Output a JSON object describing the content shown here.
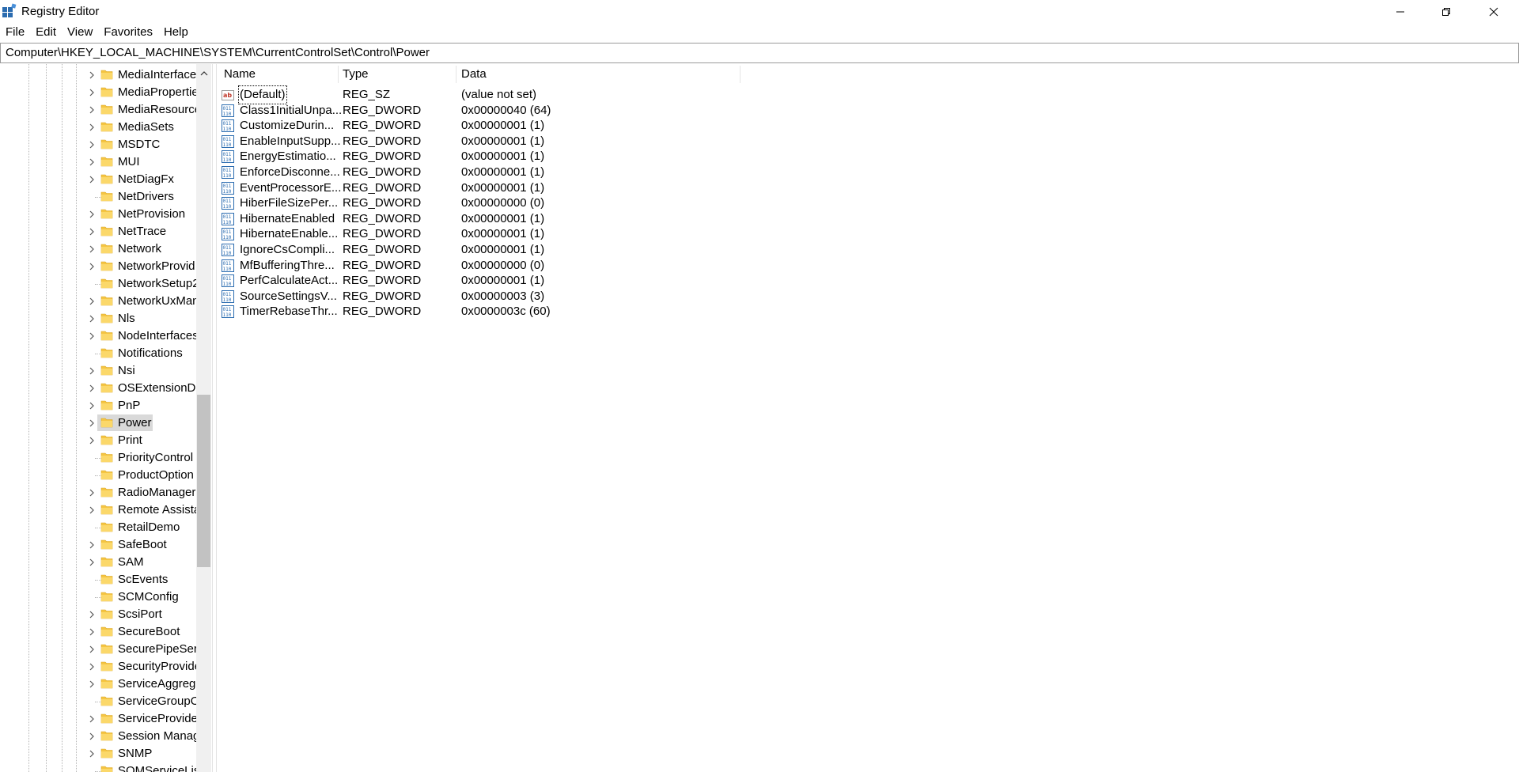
{
  "window": {
    "title": "Registry Editor",
    "icon": "registry-editor-icon",
    "controls": [
      "minimize",
      "maximize",
      "close"
    ]
  },
  "menu": [
    "File",
    "Edit",
    "View",
    "Favorites",
    "Help"
  ],
  "address": {
    "path": "Computer\\HKEY_LOCAL_MACHINE\\SYSTEM\\CurrentControlSet\\Control\\Power"
  },
  "tree": {
    "items": [
      {
        "label": "MediaInterface",
        "expandable": true
      },
      {
        "label": "MediaPropertie",
        "expandable": true
      },
      {
        "label": "MediaResource",
        "expandable": true
      },
      {
        "label": "MediaSets",
        "expandable": true
      },
      {
        "label": "MSDTC",
        "expandable": true
      },
      {
        "label": "MUI",
        "expandable": true
      },
      {
        "label": "NetDiagFx",
        "expandable": true
      },
      {
        "label": "NetDrivers",
        "expandable": false
      },
      {
        "label": "NetProvision",
        "expandable": true
      },
      {
        "label": "NetTrace",
        "expandable": true
      },
      {
        "label": "Network",
        "expandable": true
      },
      {
        "label": "NetworkProvid",
        "expandable": true
      },
      {
        "label": "NetworkSetup2",
        "expandable": false
      },
      {
        "label": "NetworkUxMan",
        "expandable": true
      },
      {
        "label": "Nls",
        "expandable": true
      },
      {
        "label": "NodeInterfaces",
        "expandable": true
      },
      {
        "label": "Notifications",
        "expandable": false
      },
      {
        "label": "Nsi",
        "expandable": true
      },
      {
        "label": "OSExtensionDa",
        "expandable": true
      },
      {
        "label": "PnP",
        "expandable": true
      },
      {
        "label": "Power",
        "expandable": true,
        "selected": true
      },
      {
        "label": "Print",
        "expandable": true
      },
      {
        "label": "PriorityControl",
        "expandable": false
      },
      {
        "label": "ProductOption",
        "expandable": false
      },
      {
        "label": "RadioManager",
        "expandable": true
      },
      {
        "label": "Remote Assista",
        "expandable": true
      },
      {
        "label": "RetailDemo",
        "expandable": false
      },
      {
        "label": "SafeBoot",
        "expandable": true
      },
      {
        "label": "SAM",
        "expandable": true
      },
      {
        "label": "ScEvents",
        "expandable": false
      },
      {
        "label": "SCMConfig",
        "expandable": false
      },
      {
        "label": "ScsiPort",
        "expandable": true
      },
      {
        "label": "SecureBoot",
        "expandable": true
      },
      {
        "label": "SecurePipeServ",
        "expandable": true
      },
      {
        "label": "SecurityProvide",
        "expandable": true
      },
      {
        "label": "ServiceAggreg",
        "expandable": true
      },
      {
        "label": "ServiceGroupO",
        "expandable": false
      },
      {
        "label": "ServiceProvide",
        "expandable": true
      },
      {
        "label": "Session Manag",
        "expandable": true
      },
      {
        "label": "SNMP",
        "expandable": true
      },
      {
        "label": "SQMServiceLis",
        "expandable": false
      }
    ]
  },
  "list": {
    "columns": [
      "Name",
      "Type",
      "Data"
    ],
    "rows": [
      {
        "name": "(Default)",
        "type": "REG_SZ",
        "data": "(value not set)",
        "icon": "string-value-icon"
      },
      {
        "name": "Class1InitialUnpa...",
        "type": "REG_DWORD",
        "data": "0x00000040 (64)",
        "icon": "binary-value-icon"
      },
      {
        "name": "CustomizeDurin...",
        "type": "REG_DWORD",
        "data": "0x00000001 (1)",
        "icon": "binary-value-icon"
      },
      {
        "name": "EnableInputSupp...",
        "type": "REG_DWORD",
        "data": "0x00000001 (1)",
        "icon": "binary-value-icon"
      },
      {
        "name": "EnergyEstimatio...",
        "type": "REG_DWORD",
        "data": "0x00000001 (1)",
        "icon": "binary-value-icon"
      },
      {
        "name": "EnforceDisconne...",
        "type": "REG_DWORD",
        "data": "0x00000001 (1)",
        "icon": "binary-value-icon"
      },
      {
        "name": "EventProcessorE...",
        "type": "REG_DWORD",
        "data": "0x00000001 (1)",
        "icon": "binary-value-icon"
      },
      {
        "name": "HiberFileSizePer...",
        "type": "REG_DWORD",
        "data": "0x00000000 (0)",
        "icon": "binary-value-icon"
      },
      {
        "name": "HibernateEnabled",
        "type": "REG_DWORD",
        "data": "0x00000001 (1)",
        "icon": "binary-value-icon"
      },
      {
        "name": "HibernateEnable...",
        "type": "REG_DWORD",
        "data": "0x00000001 (1)",
        "icon": "binary-value-icon"
      },
      {
        "name": "IgnoreCsCompli...",
        "type": "REG_DWORD",
        "data": "0x00000001 (1)",
        "icon": "binary-value-icon"
      },
      {
        "name": "MfBufferingThre...",
        "type": "REG_DWORD",
        "data": "0x00000000 (0)",
        "icon": "binary-value-icon"
      },
      {
        "name": "PerfCalculateAct...",
        "type": "REG_DWORD",
        "data": "0x00000001 (1)",
        "icon": "binary-value-icon"
      },
      {
        "name": "SourceSettingsV...",
        "type": "REG_DWORD",
        "data": "0x00000003 (3)",
        "icon": "binary-value-icon"
      },
      {
        "name": "TimerRebaseThr...",
        "type": "REG_DWORD",
        "data": "0x0000003c (60)",
        "icon": "binary-value-icon"
      }
    ]
  },
  "colors": {
    "folder": "#f5c542",
    "selection": "#d9d9d9",
    "registry_icon_blue": "#2b6cb0",
    "string_icon_red": "#c0392b"
  }
}
